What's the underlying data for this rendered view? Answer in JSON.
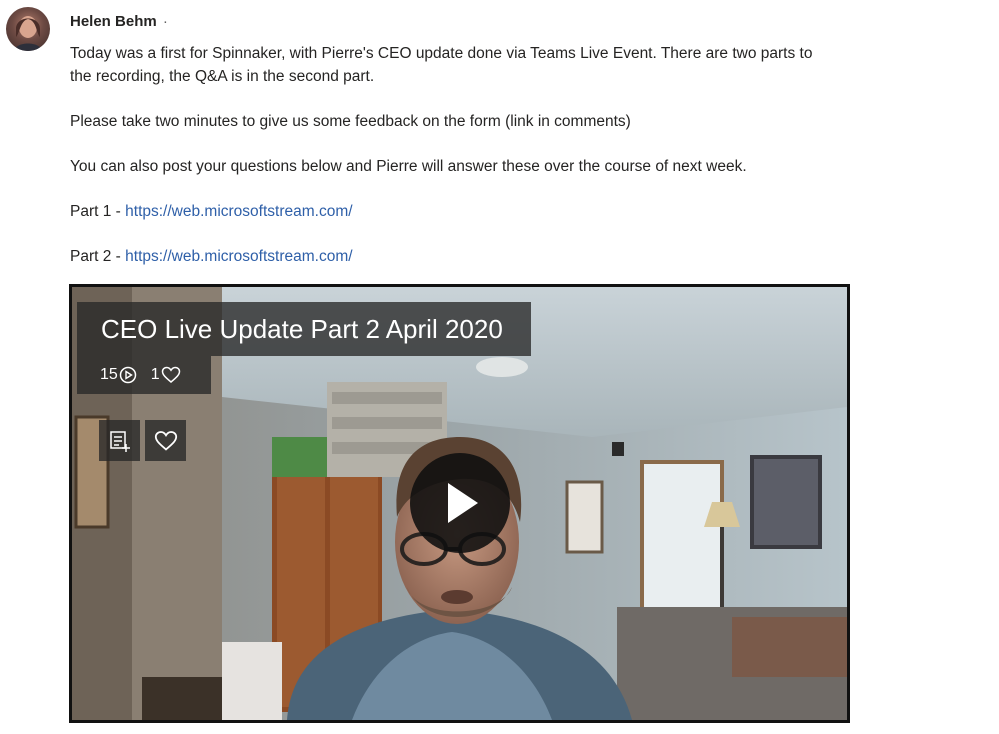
{
  "post": {
    "author": "Helen Behm",
    "author_separator": "·",
    "paragraphs": [
      "Today was a first for Spinnaker, with Pierre's CEO update done via Teams Live Event.  There are two parts to the recording, the Q&A is in the second part.",
      "Please take two minutes to give us some feedback on the form (link in comments)",
      "You can also post your questions below and Pierre will answer these over the course of next week."
    ],
    "links": [
      {
        "prefix": "Part 1 - ",
        "url": "https://web.microsoftstream.com/"
      },
      {
        "prefix": "Part 2 - ",
        "url": "https://web.microsoftstream.com/"
      }
    ]
  },
  "video": {
    "title": "CEO Live Update Part 2 April 2020",
    "views": "15",
    "likes": "1",
    "icons": {
      "views": "play-circle-icon",
      "likes": "heart-outline-icon",
      "playlist": "add-to-playlist-icon",
      "like_button": "heart-outline-icon",
      "play": "play-icon"
    }
  },
  "colors": {
    "link": "#2e5fa8",
    "text": "#252423",
    "overlay": "#282828"
  }
}
